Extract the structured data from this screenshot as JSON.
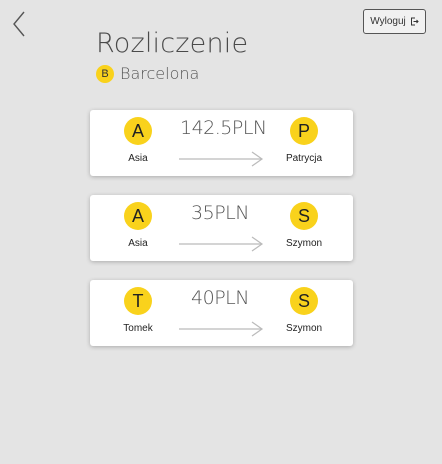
{
  "header": {
    "title": "Rozliczenie",
    "logout_label": "Wyloguj"
  },
  "group": {
    "initial": "B",
    "name": "Barcelona"
  },
  "settlements": [
    {
      "from": {
        "initial": "A",
        "name": "Asia"
      },
      "amount": "142.5PLN",
      "to": {
        "initial": "P",
        "name": "Patrycja"
      }
    },
    {
      "from": {
        "initial": "A",
        "name": "Asia"
      },
      "amount": "35PLN",
      "to": {
        "initial": "S",
        "name": "Szymon"
      }
    },
    {
      "from": {
        "initial": "T",
        "name": "Tomek"
      },
      "amount": "40PLN",
      "to": {
        "initial": "S",
        "name": "Szymon"
      }
    }
  ],
  "colors": {
    "accent": "#f9d21c",
    "background": "#e4e4e4",
    "card": "#ffffff"
  },
  "icons": {
    "back": "chevron-left-icon",
    "logout": "logout-icon",
    "arrow": "arrow-right-icon"
  }
}
